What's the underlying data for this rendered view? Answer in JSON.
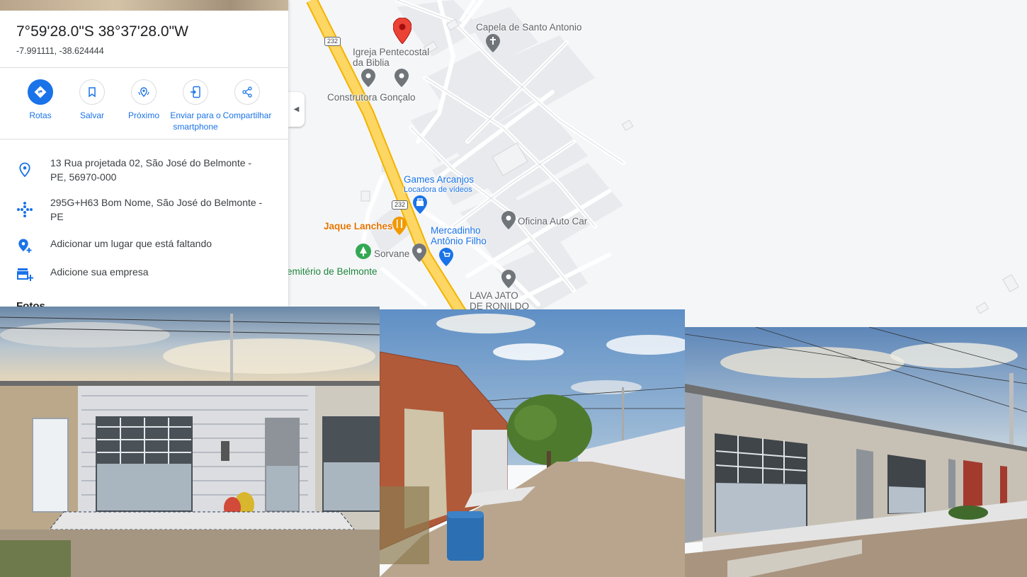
{
  "place": {
    "coords_dms": "7°59'28.0\"S 38°37'28.0\"W",
    "coords_decimal": "-7.991111, -38.624444"
  },
  "actions": [
    {
      "label": "Rotas",
      "icon": "directions-icon"
    },
    {
      "label": "Salvar",
      "icon": "bookmark-icon"
    },
    {
      "label": "Próximo",
      "icon": "nearby-icon"
    },
    {
      "label": "Enviar para o smartphone",
      "icon": "send-to-phone-icon"
    },
    {
      "label": "Compartilhar",
      "icon": "share-icon"
    }
  ],
  "info": {
    "address": "13 Rua projetada 02, São José do Belmonte - PE, 56970-000",
    "plus_code": "295G+H63 Bom Nome, São José do Belmonte - PE",
    "add_place": "Adicionar um lugar que está faltando",
    "add_business": "Adicione sua empresa"
  },
  "photos_heading": "Fotos",
  "map": {
    "labels": {
      "capela": "Capela de Santo Antonio",
      "igreja": "Igreja Pentecostal da Biblia",
      "construtora": "Construtora Gonçalo",
      "games": "Games Arcanjos",
      "games_sub": "Locadora de vídeos",
      "jaque": "Jaque Lanches",
      "mercadinho": "Mercadinho Antônio Filho",
      "oficina": "Oficina Auto Car",
      "sorvane": "Sorvane",
      "cemiterio": "emitério de Belmonte",
      "lavajato": "LAVA JATO DE RONILDO"
    },
    "road_number": "232",
    "colors": {
      "highway": "#fdd663",
      "highway_edge": "#f2b400",
      "pin": "#ea4335",
      "poi_grey": "#70757a",
      "poi_blue": "#1a73e8",
      "poi_orange": "#f29900",
      "poi_green": "#34a853"
    }
  }
}
